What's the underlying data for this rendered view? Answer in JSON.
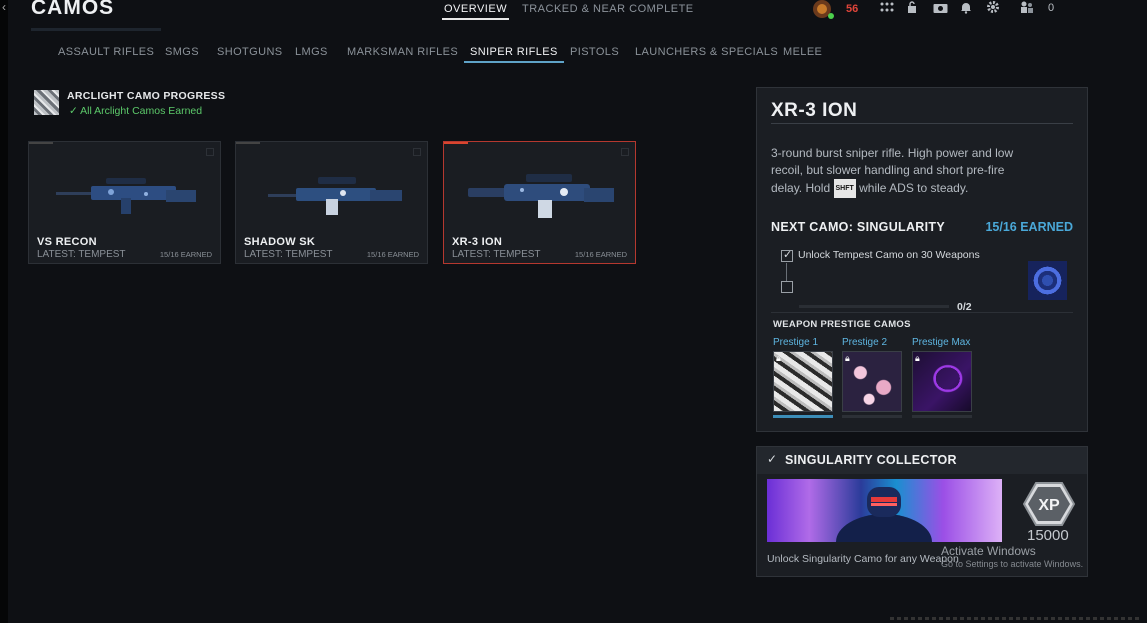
{
  "header": {
    "back_icon": "chevron-left-icon",
    "title": "CAMOS",
    "tabs": [
      {
        "label": "OVERVIEW",
        "active": true
      },
      {
        "label": "TRACKED & NEAR COMPLETE",
        "active": false
      }
    ],
    "player_level": "56",
    "friends_count": "0",
    "icons": [
      "rank-emblem-icon",
      "grid-apps-icon",
      "store-lock-icon",
      "camera-icon",
      "bell-icon",
      "gear-icon",
      "party-icon"
    ]
  },
  "categories": [
    {
      "label": "ASSAULT RIFLES",
      "active": false
    },
    {
      "label": "SMGS",
      "active": false
    },
    {
      "label": "SHOTGUNS",
      "active": false
    },
    {
      "label": "LMGS",
      "active": false
    },
    {
      "label": "MARKSMAN RIFLES",
      "active": false
    },
    {
      "label": "SNIPER RIFLES",
      "active": true
    },
    {
      "label": "PISTOLS",
      "active": false
    },
    {
      "label": "LAUNCHERS & SPECIALS",
      "active": false
    },
    {
      "label": "MELEE",
      "active": false
    }
  ],
  "arclight": {
    "title": "ARCLIGHT CAMO PROGRESS",
    "status": "✓ All Arclight Camos Earned"
  },
  "weapons": [
    {
      "name": "VS RECON",
      "latest": "LATEST: TEMPEST",
      "earned": "15/16 EARNED",
      "selected": false
    },
    {
      "name": "SHADOW SK",
      "latest": "LATEST: TEMPEST",
      "earned": "15/16 EARNED",
      "selected": false
    },
    {
      "name": "XR-3 ION",
      "latest": "LATEST: TEMPEST",
      "earned": "15/16 EARNED",
      "selected": true
    }
  ],
  "detail": {
    "name": "XR-3 ION",
    "desc_before_key": "3-round burst sniper rifle. High power and low recoil, but slower handling and short pre-fire delay. Hold",
    "key": "SHFT",
    "desc_after_key": "while ADS to steady.",
    "next_camo": "NEXT CAMO: SINGULARITY",
    "earned": "15/16 EARNED",
    "challenge": "Unlock Tempest Camo on 30 Weapons",
    "progress": "0/2",
    "progress_value": 0.0,
    "prestige_heading": "WEAPON PRESTIGE CAMOS",
    "prestige": [
      {
        "label": "Prestige 1",
        "locked": true
      },
      {
        "label": "Prestige 2",
        "locked": true
      },
      {
        "label": "Prestige Max",
        "locked": true
      }
    ]
  },
  "reward": {
    "title": "SINGULARITY COLLECTOR",
    "xp_label": "XP",
    "xp_amount": "15000",
    "desc": "Unlock Singularity Camo for any Weapon"
  },
  "watermark": {
    "line1": "Activate Windows",
    "line2": "Go to Settings to activate Windows."
  },
  "colors": {
    "accent_blue": "#4aa8d8",
    "selected_red": "#d9452f",
    "success_green": "#5cc96a",
    "level_red": "#e0453a"
  }
}
